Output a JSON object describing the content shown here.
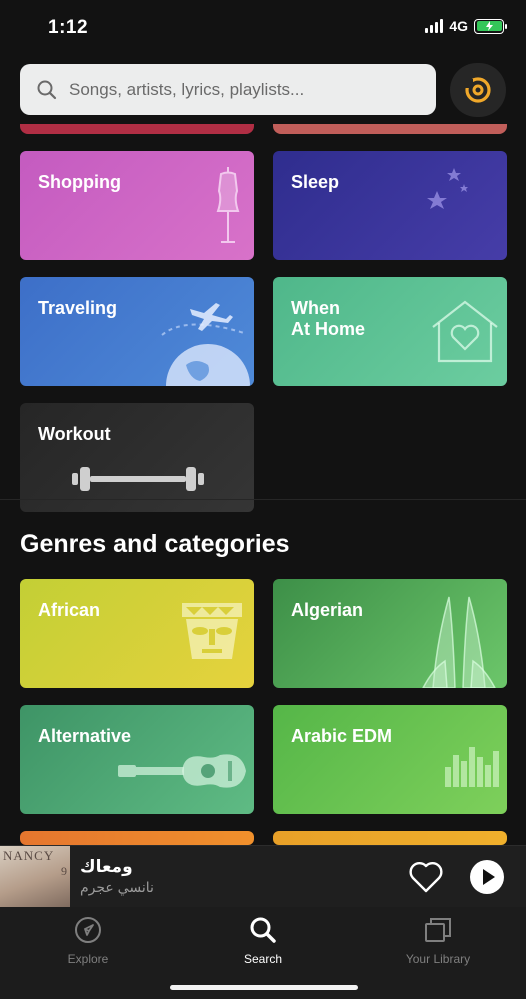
{
  "status_bar": {
    "time": "1:12",
    "network": "4G"
  },
  "search": {
    "placeholder": "Songs, artists, lyrics, playlists..."
  },
  "moods": [
    {
      "label": "Shopping",
      "color_from": "#c45bc0",
      "color_to": "#d872c9",
      "icon": "mannequin-icon"
    },
    {
      "label": "Sleep",
      "color_from": "#2f2d8e",
      "color_to": "#463da8",
      "icon": "moon-stars-icon"
    },
    {
      "label": "Traveling",
      "color_from": "#3d6fc8",
      "color_to": "#4f8ad8",
      "icon": "plane-globe-icon"
    },
    {
      "label": "When\nAt Home",
      "color_from": "#4fb78a",
      "color_to": "#6ccda0",
      "icon": "house-heart-icon"
    },
    {
      "label": "Workout",
      "color_from": "#262626",
      "color_to": "#353535",
      "icon": "dumbbell-icon"
    }
  ],
  "genres_section": {
    "title": "Genres and categories"
  },
  "genres": [
    {
      "label": "African",
      "color_from": "#c3cf35",
      "color_to": "#e6d23d",
      "icon": "african-mask-icon"
    },
    {
      "label": "Algerian",
      "color_from": "#3d8f48",
      "color_to": "#6cc66a",
      "icon": "monument-icon"
    },
    {
      "label": "Alternative",
      "color_from": "#3e9466",
      "color_to": "#5fbb84",
      "icon": "guitar-icon"
    },
    {
      "label": "Arabic EDM",
      "color_from": "#55b648",
      "color_to": "#7ed05b",
      "icon": "equalizer-icon"
    }
  ],
  "now_playing": {
    "title": "ومعاك",
    "artist": "نانسي عجرم",
    "album_text": "NANCY",
    "album_number": "9"
  },
  "tabs": [
    {
      "label": "Explore",
      "icon": "compass-icon",
      "active": false
    },
    {
      "label": "Search",
      "icon": "search-icon",
      "active": true
    },
    {
      "label": "Your Library",
      "icon": "library-icon",
      "active": false
    }
  ]
}
